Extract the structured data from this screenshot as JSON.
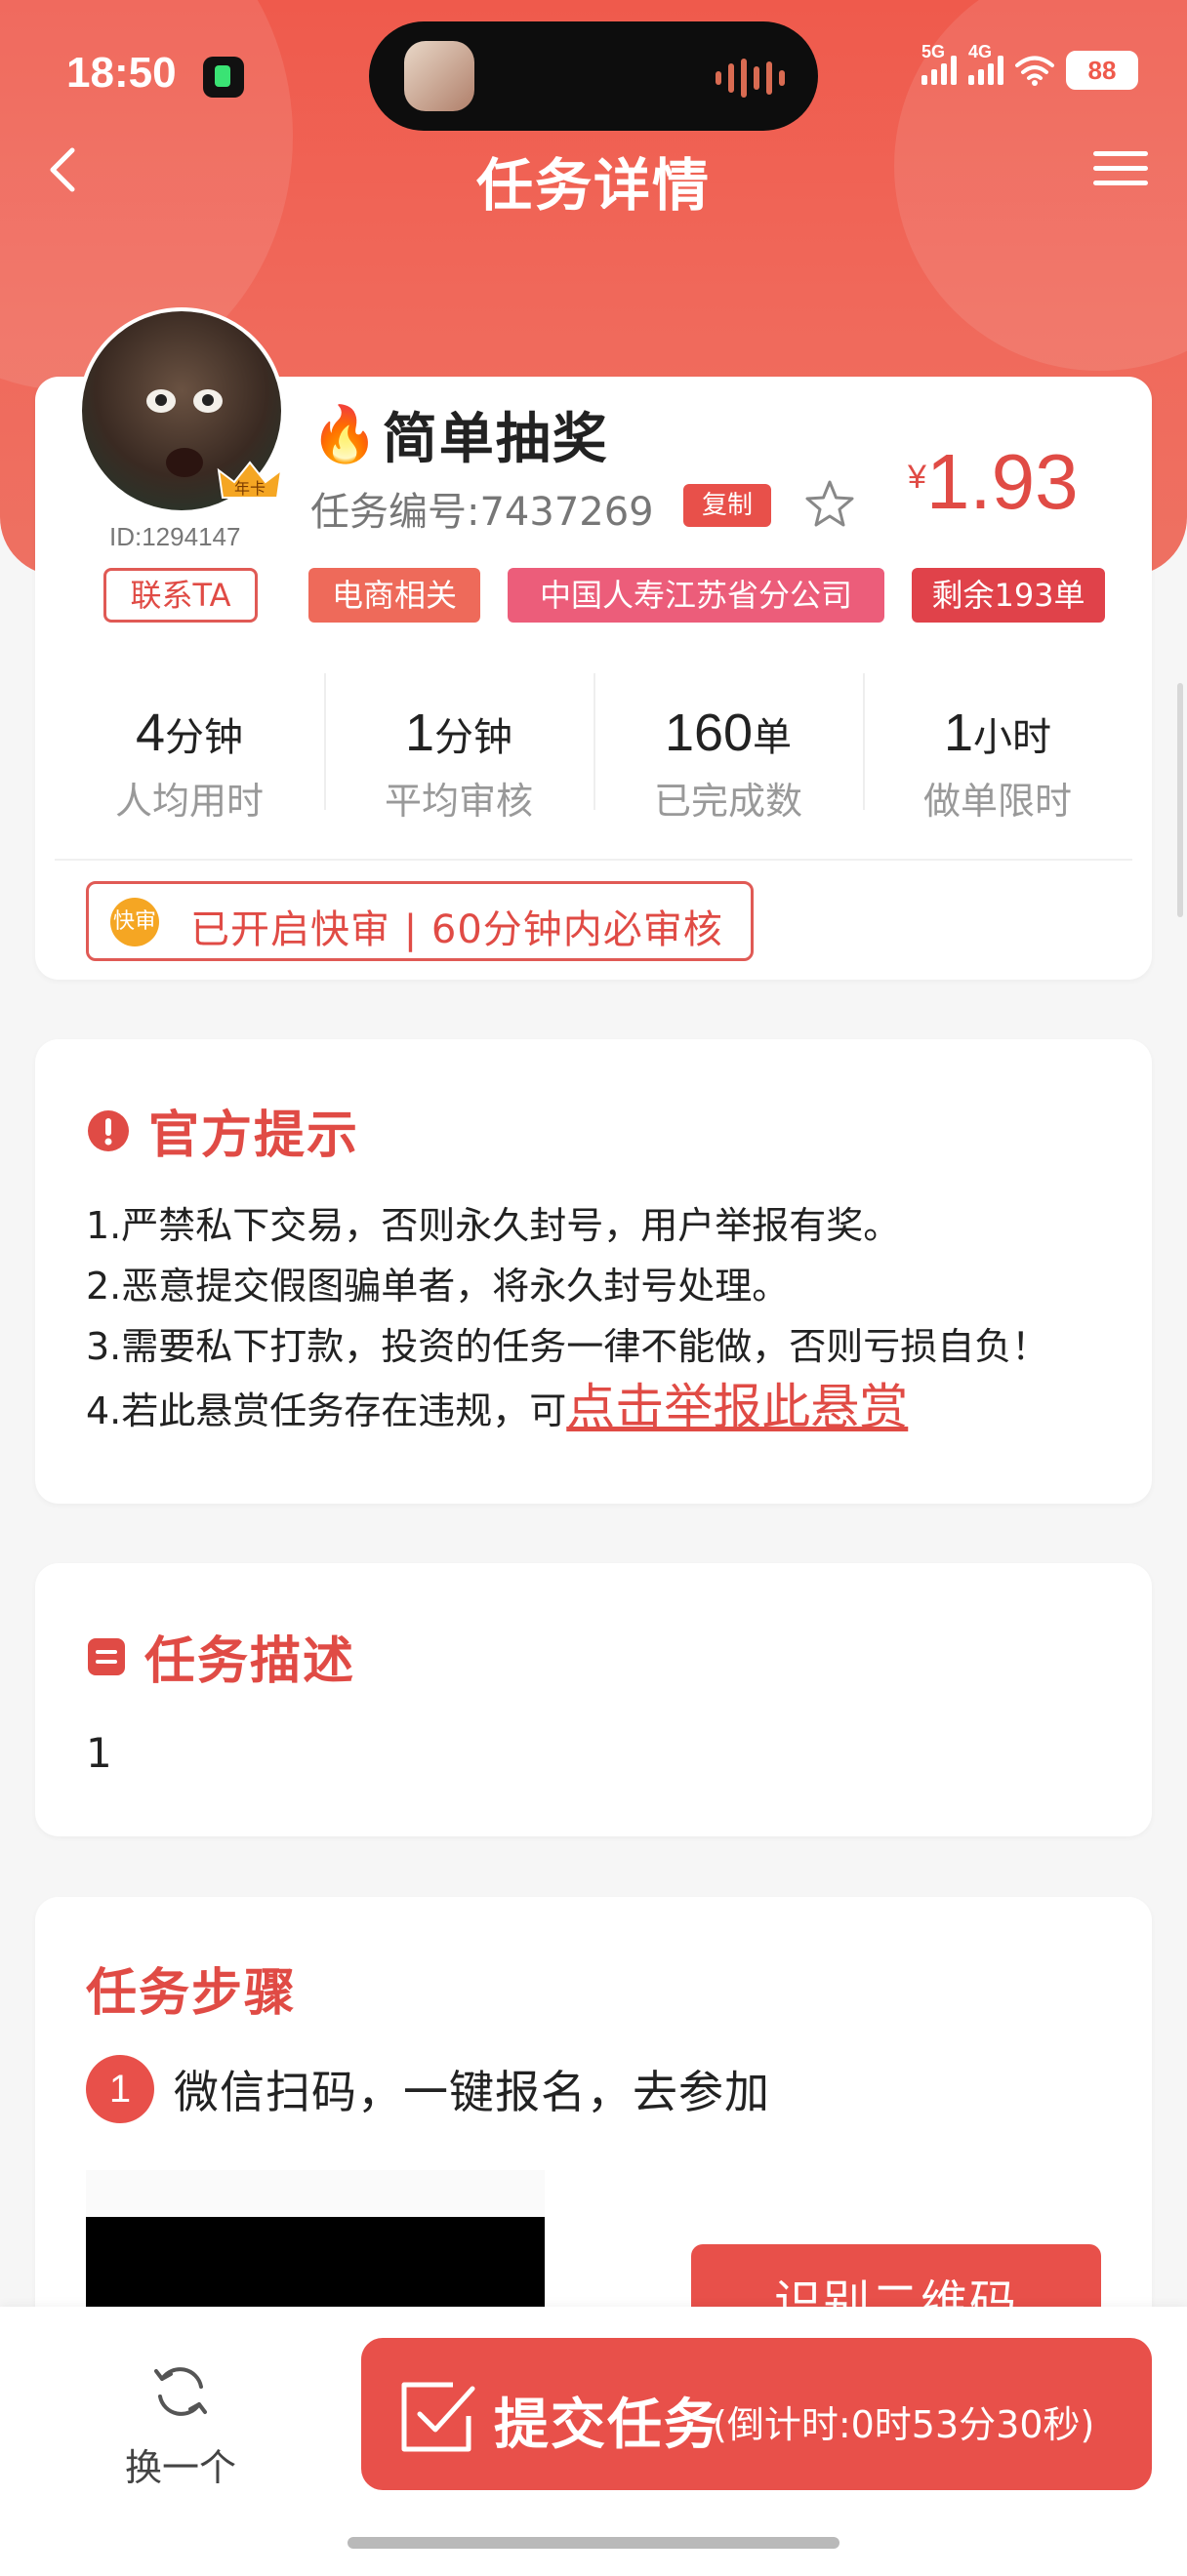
{
  "status": {
    "time": "18:50",
    "net1": "5G",
    "net2": "4G",
    "battery": "88"
  },
  "header": {
    "title": "任务详情"
  },
  "colors": {
    "brand": "#e8504a",
    "hero": "#ef5a4c",
    "tag_blue_pink": "#ec5d7a",
    "accent_gold": "#f5a623"
  },
  "user": {
    "id": "ID:1294147",
    "badge": "年卡",
    "contact_label": "联系TA"
  },
  "task": {
    "icon": "fire-icon",
    "title": "简单抽奖",
    "number": "任务编号:7437269",
    "copy_label": "复制",
    "price_currency": "¥",
    "price": "1.93",
    "tags": [
      "电商相关",
      "中国人寿江苏省分公司",
      "剩余193单"
    ]
  },
  "stats": [
    {
      "value": "4",
      "unit": "分钟",
      "label": "人均用时"
    },
    {
      "value": "1",
      "unit": "分钟",
      "label": "平均审核"
    },
    {
      "value": "160",
      "unit": "单",
      "label": "已完成数"
    },
    {
      "value": "1",
      "unit": "小时",
      "label": "做单限时"
    }
  ],
  "fast_review": {
    "icon_label": "快审",
    "text": "已开启快审 | 60分钟内必审核"
  },
  "notice": {
    "title": "官方提示",
    "lines": [
      "1.严禁私下交易，否则永久封号，用户举报有奖。",
      "2.恶意提交假图骗单者，将永久封号处理。",
      "3.需要私下打款，投资的任务一律不能做，否则亏损自负！",
      "4.若此悬赏任务存在违规，可"
    ],
    "report_link": "点击举报此悬赏"
  },
  "description": {
    "title": "任务描述",
    "text": "1"
  },
  "steps": {
    "title": "任务步骤",
    "items": [
      {
        "num": "1",
        "text": "微信扫码，一键报名，去参加"
      }
    ],
    "qr_button": "识别二维码"
  },
  "bottom": {
    "swap_label": "换一个",
    "submit_label": "提交任务",
    "countdown": "(倒计时:0时53分30秒)"
  }
}
